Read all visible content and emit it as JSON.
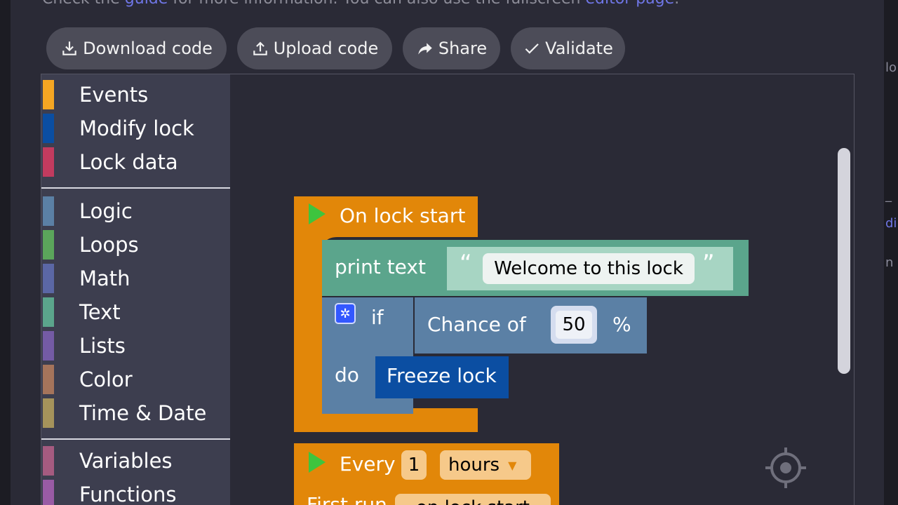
{
  "info": {
    "prefix": "Check the ",
    "guide_link": "guide",
    "middle": " for more information. You can also use the fullscreen ",
    "editor_link": "editor page",
    "suffix": "."
  },
  "toolbar": {
    "download": "Download code",
    "upload": "Upload code",
    "share": "Share",
    "validate": "Validate"
  },
  "toolbox": {
    "groups": [
      [
        {
          "label": "Events",
          "color": "#f5a623"
        },
        {
          "label": "Modify lock",
          "color": "#0b4ea2"
        },
        {
          "label": "Lock data",
          "color": "#c23b5f"
        }
      ],
      [
        {
          "label": "Logic",
          "color": "#5b80a5"
        },
        {
          "label": "Loops",
          "color": "#5ba55b"
        },
        {
          "label": "Math",
          "color": "#5b67a5"
        },
        {
          "label": "Text",
          "color": "#5ba58c"
        },
        {
          "label": "Lists",
          "color": "#745ba5"
        },
        {
          "label": "Color",
          "color": "#a5745b"
        },
        {
          "label": "Time & Date",
          "color": "#a5935b"
        }
      ],
      [
        {
          "label": "Variables",
          "color": "#a55b80"
        },
        {
          "label": "Functions",
          "color": "#995ba5"
        }
      ]
    ]
  },
  "blocks": {
    "on_start": "On lock start",
    "print_text": "print text",
    "open_quote": "“",
    "welcome": "Welcome to this lock",
    "close_quote": "”",
    "if": "if",
    "chance_of": "Chance of",
    "chance_value": "50",
    "percent": "%",
    "do": "do",
    "freeze": "Freeze lock",
    "every": "Every",
    "every_value": "1",
    "every_unit": "hours",
    "first_run": "First run",
    "first_run_value": "on lock start"
  },
  "colors": {
    "event": "#e28709",
    "text_block": "#5ba58c",
    "logic_block": "#5b80a5",
    "lock_block": "#0b4ea2"
  },
  "right_fragments": [
    "lo",
    "_",
    "di",
    "n"
  ]
}
